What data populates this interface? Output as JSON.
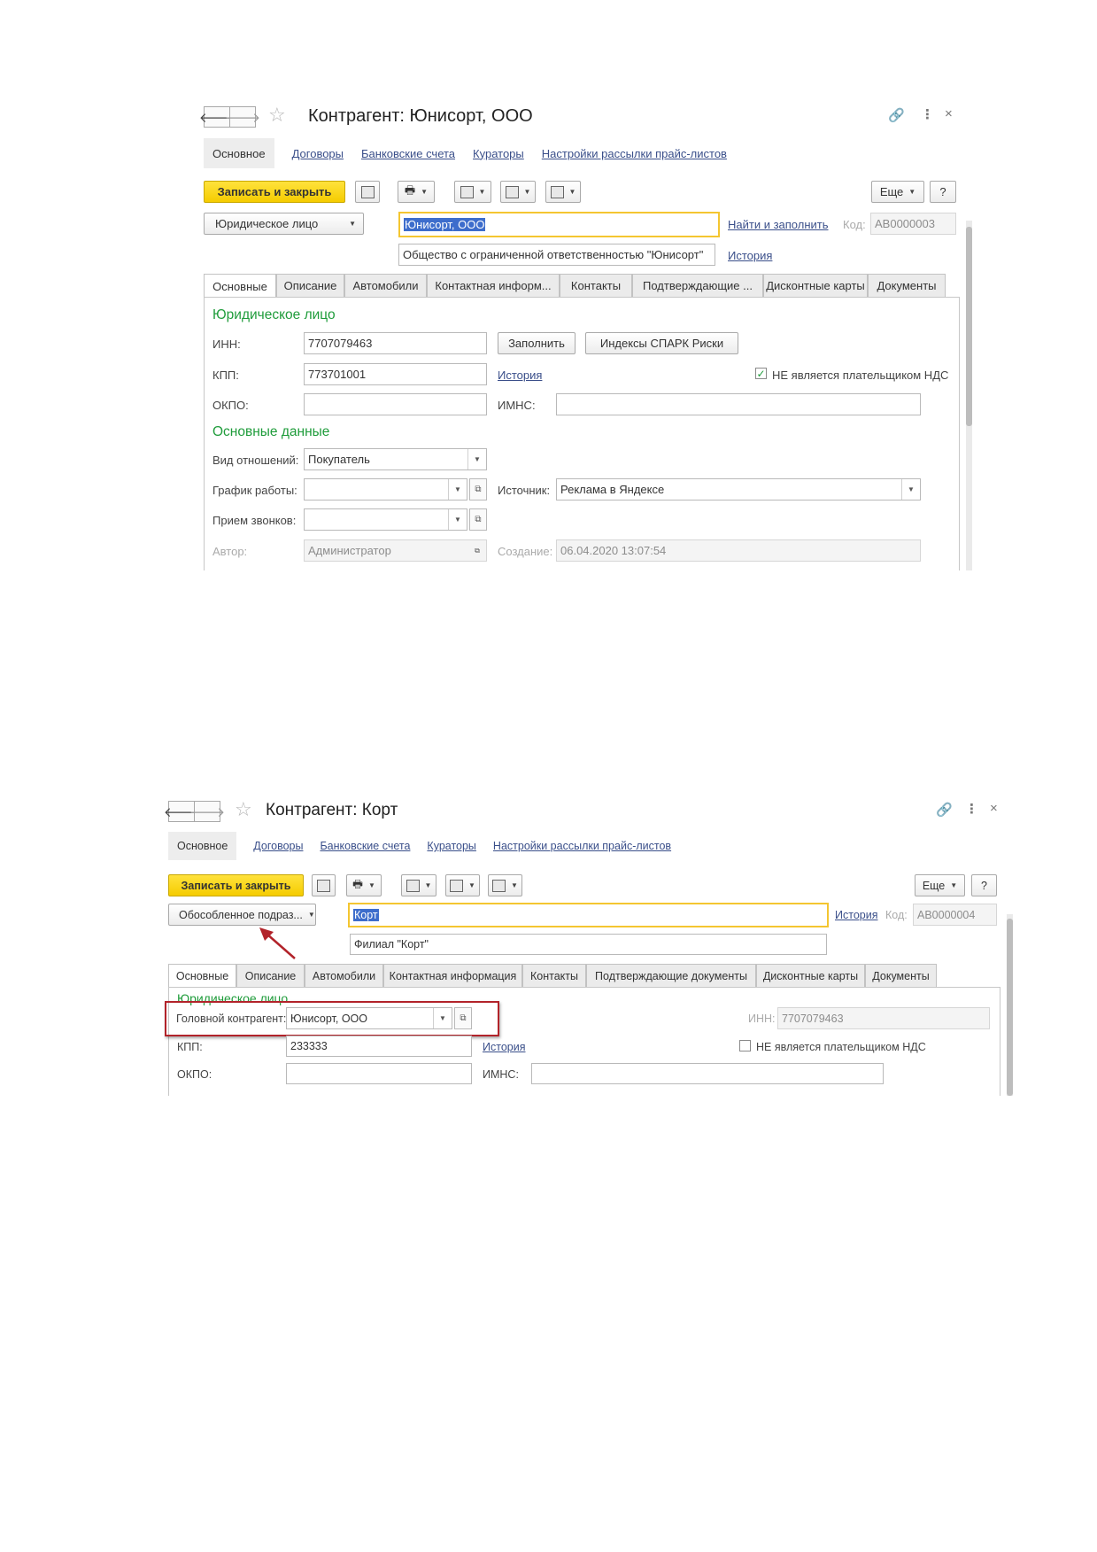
{
  "form1": {
    "title": "Контрагент: Юнисорт, ООО",
    "nav": {
      "current": "Основное",
      "links": [
        "Договоры",
        "Банковские счета",
        "Кураторы",
        "Настройки рассылки прайс-листов"
      ]
    },
    "toolbar": {
      "save_close": "Записать и закрыть",
      "more": "Еще",
      "help": "?"
    },
    "entity_type": "Юридическое лицо",
    "name": "Юнисорт, ООО",
    "find_fill": "Найти и заполнить",
    "code_label": "Код:",
    "code": "АВ0000003",
    "full_name": "Общество с ограниченной ответственностью \"Юнисорт\"",
    "history": "История",
    "tabs": [
      "Основные",
      "Описание",
      "Автомобили",
      "Контактная информ...",
      "Контакты",
      "Подтверждающие ...",
      "Дисконтные карты",
      "Документы"
    ],
    "group_legal": "Юридическое лицо",
    "inn_label": "ИНН:",
    "inn": "7707079463",
    "fill_btn": "Заполнить",
    "spark_btn": "Индексы СПАРК Риски",
    "kpp_label": "КПП:",
    "kpp": "773701001",
    "kpp_history": "История",
    "vat_label": "НЕ является плательщиком НДС",
    "vat_checked": true,
    "okpo_label": "ОКПО:",
    "okpo": "",
    "imns_label": "ИМНС:",
    "imns": "",
    "group_main": "Основные данные",
    "relation_label": "Вид отношений:",
    "relation": "Покупатель",
    "schedule_label": "График работы:",
    "schedule": "",
    "source_label": "Источник:",
    "source": "Реклама в Яндексе",
    "calls_label": "Прием звонков:",
    "calls": "",
    "author_label": "Автор:",
    "author": "Администратор",
    "created_label": "Создание:",
    "created": "06.04.2020 13:07:54"
  },
  "form2": {
    "title": "Контрагент: Корт",
    "nav": {
      "current": "Основное",
      "links": [
        "Договоры",
        "Банковские счета",
        "Кураторы",
        "Настройки рассылки прайс-листов"
      ]
    },
    "toolbar": {
      "save_close": "Записать и закрыть",
      "more": "Еще",
      "help": "?"
    },
    "entity_type": "Обособленное подраз...",
    "name": "Корт",
    "history": "История",
    "code_label": "Код:",
    "code": "АВ0000004",
    "full_name": "Филиал \"Корт\"",
    "tabs": [
      "Основные",
      "Описание",
      "Автомобили",
      "Контактная информация",
      "Контакты",
      "Подтверждающие документы",
      "Дисконтные карты",
      "Документы"
    ],
    "group_legal": "Юридическое лицо",
    "parent_label": "Головной контрагент:",
    "parent": "Юнисорт, ООО",
    "inn_label": "ИНН:",
    "inn": "7707079463",
    "kpp_label": "КПП:",
    "kpp": "233333",
    "kpp_history": "История",
    "vat_label": "НЕ является плательщиком НДС",
    "vat_checked": false,
    "okpo_label": "ОКПО:",
    "okpo": "",
    "imns_label": "ИМНС:",
    "imns": ""
  },
  "colors": {
    "accent_yellow": "#f5cc00",
    "group_green": "#1f9c3b",
    "link_blue": "#3a4f8a",
    "annotation_red": "#b2232a"
  }
}
